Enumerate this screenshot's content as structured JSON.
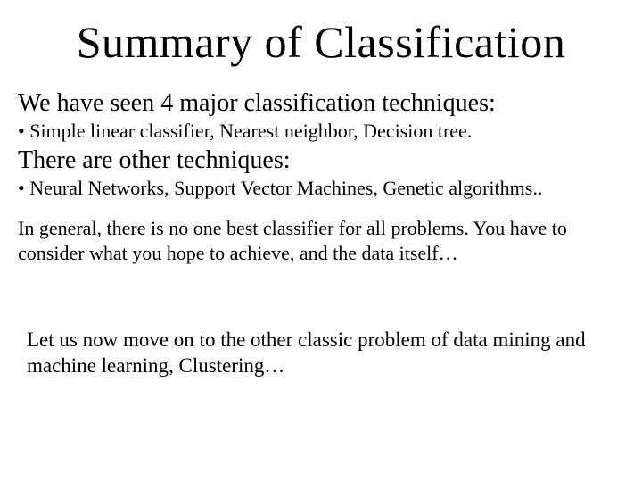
{
  "title": "Summary of Classification",
  "line1": "We have seen 4 major classification techniques:",
  "bullet1": "• Simple linear classifier, Nearest neighbor, Decision tree.",
  "line2": "There are other techniques:",
  "bullet2": "• Neural Networks, Support Vector Machines, Genetic algorithms..",
  "para1": "In general, there is no one best classifier for all problems. You have to consider what you hope to achieve, and the data itself…",
  "closing": "Let us now move on to the other classic problem of data mining and machine learning, Clustering…"
}
